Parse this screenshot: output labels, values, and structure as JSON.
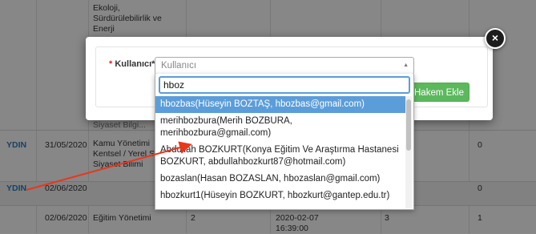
{
  "background": {
    "top_cell": [
      "Ekoloji,",
      "Sürdürülebilirlik ve",
      "Enerji"
    ],
    "top_cell_cut": "Siyaset Bilgi...",
    "rows": [
      {
        "c1": "YDIN",
        "c2": "31/05/2020",
        "c3": [
          "Kamu Yönetimi",
          "Kentsel / Yerel S...",
          "Siyaset Bilimi"
        ],
        "c4": "0"
      },
      {
        "c1": "YDIN",
        "c2": "02/06/2020",
        "c3": [],
        "c4": "0"
      },
      {
        "c1": "",
        "c2": "02/06/2020",
        "c3": [
          "Eğitim Yönetimi"
        ],
        "c_num": "2",
        "c_date": [
          "2020-02-07",
          "16:39:00"
        ],
        "c_num2": "3",
        "c4": "1"
      }
    ]
  },
  "modal": {
    "label_required": "*",
    "label_text": "Kullanıcı*",
    "select_placeholder": "Kullanıcı",
    "hakem_button": "Hakem Ekle",
    "close_glyph": "×"
  },
  "dropdown": {
    "search_value": "hboz",
    "options": [
      {
        "text": "hbozbas(Hüseyin BOZTAŞ, hbozbas@gmail.com)",
        "highlighted": true
      },
      {
        "text": "merihbozbura(Merih BOZBURA, merihbozbura@gmail.com)",
        "highlighted": false
      },
      {
        "text": "Abdullah BOZKURT(Konya Eğitim Ve Araştırma Hastanesi BOZKURT, abdullahbozkurt87@hotmail.com)",
        "highlighted": false
      },
      {
        "text": "bozaslan(Hasan BOZASLAN, hbozaslan@gmail.com)",
        "highlighted": false
      },
      {
        "text": "hbozkurt1(Hüseyin BOZKURT, hbozkurt@gantep.edu.tr)",
        "highlighted": false
      }
    ]
  },
  "colors": {
    "accent_highlight": "#5b9dd9",
    "button_green": "#5cb85c",
    "required_red": "#d9232e",
    "annotation_arrow": "#e8371c"
  }
}
